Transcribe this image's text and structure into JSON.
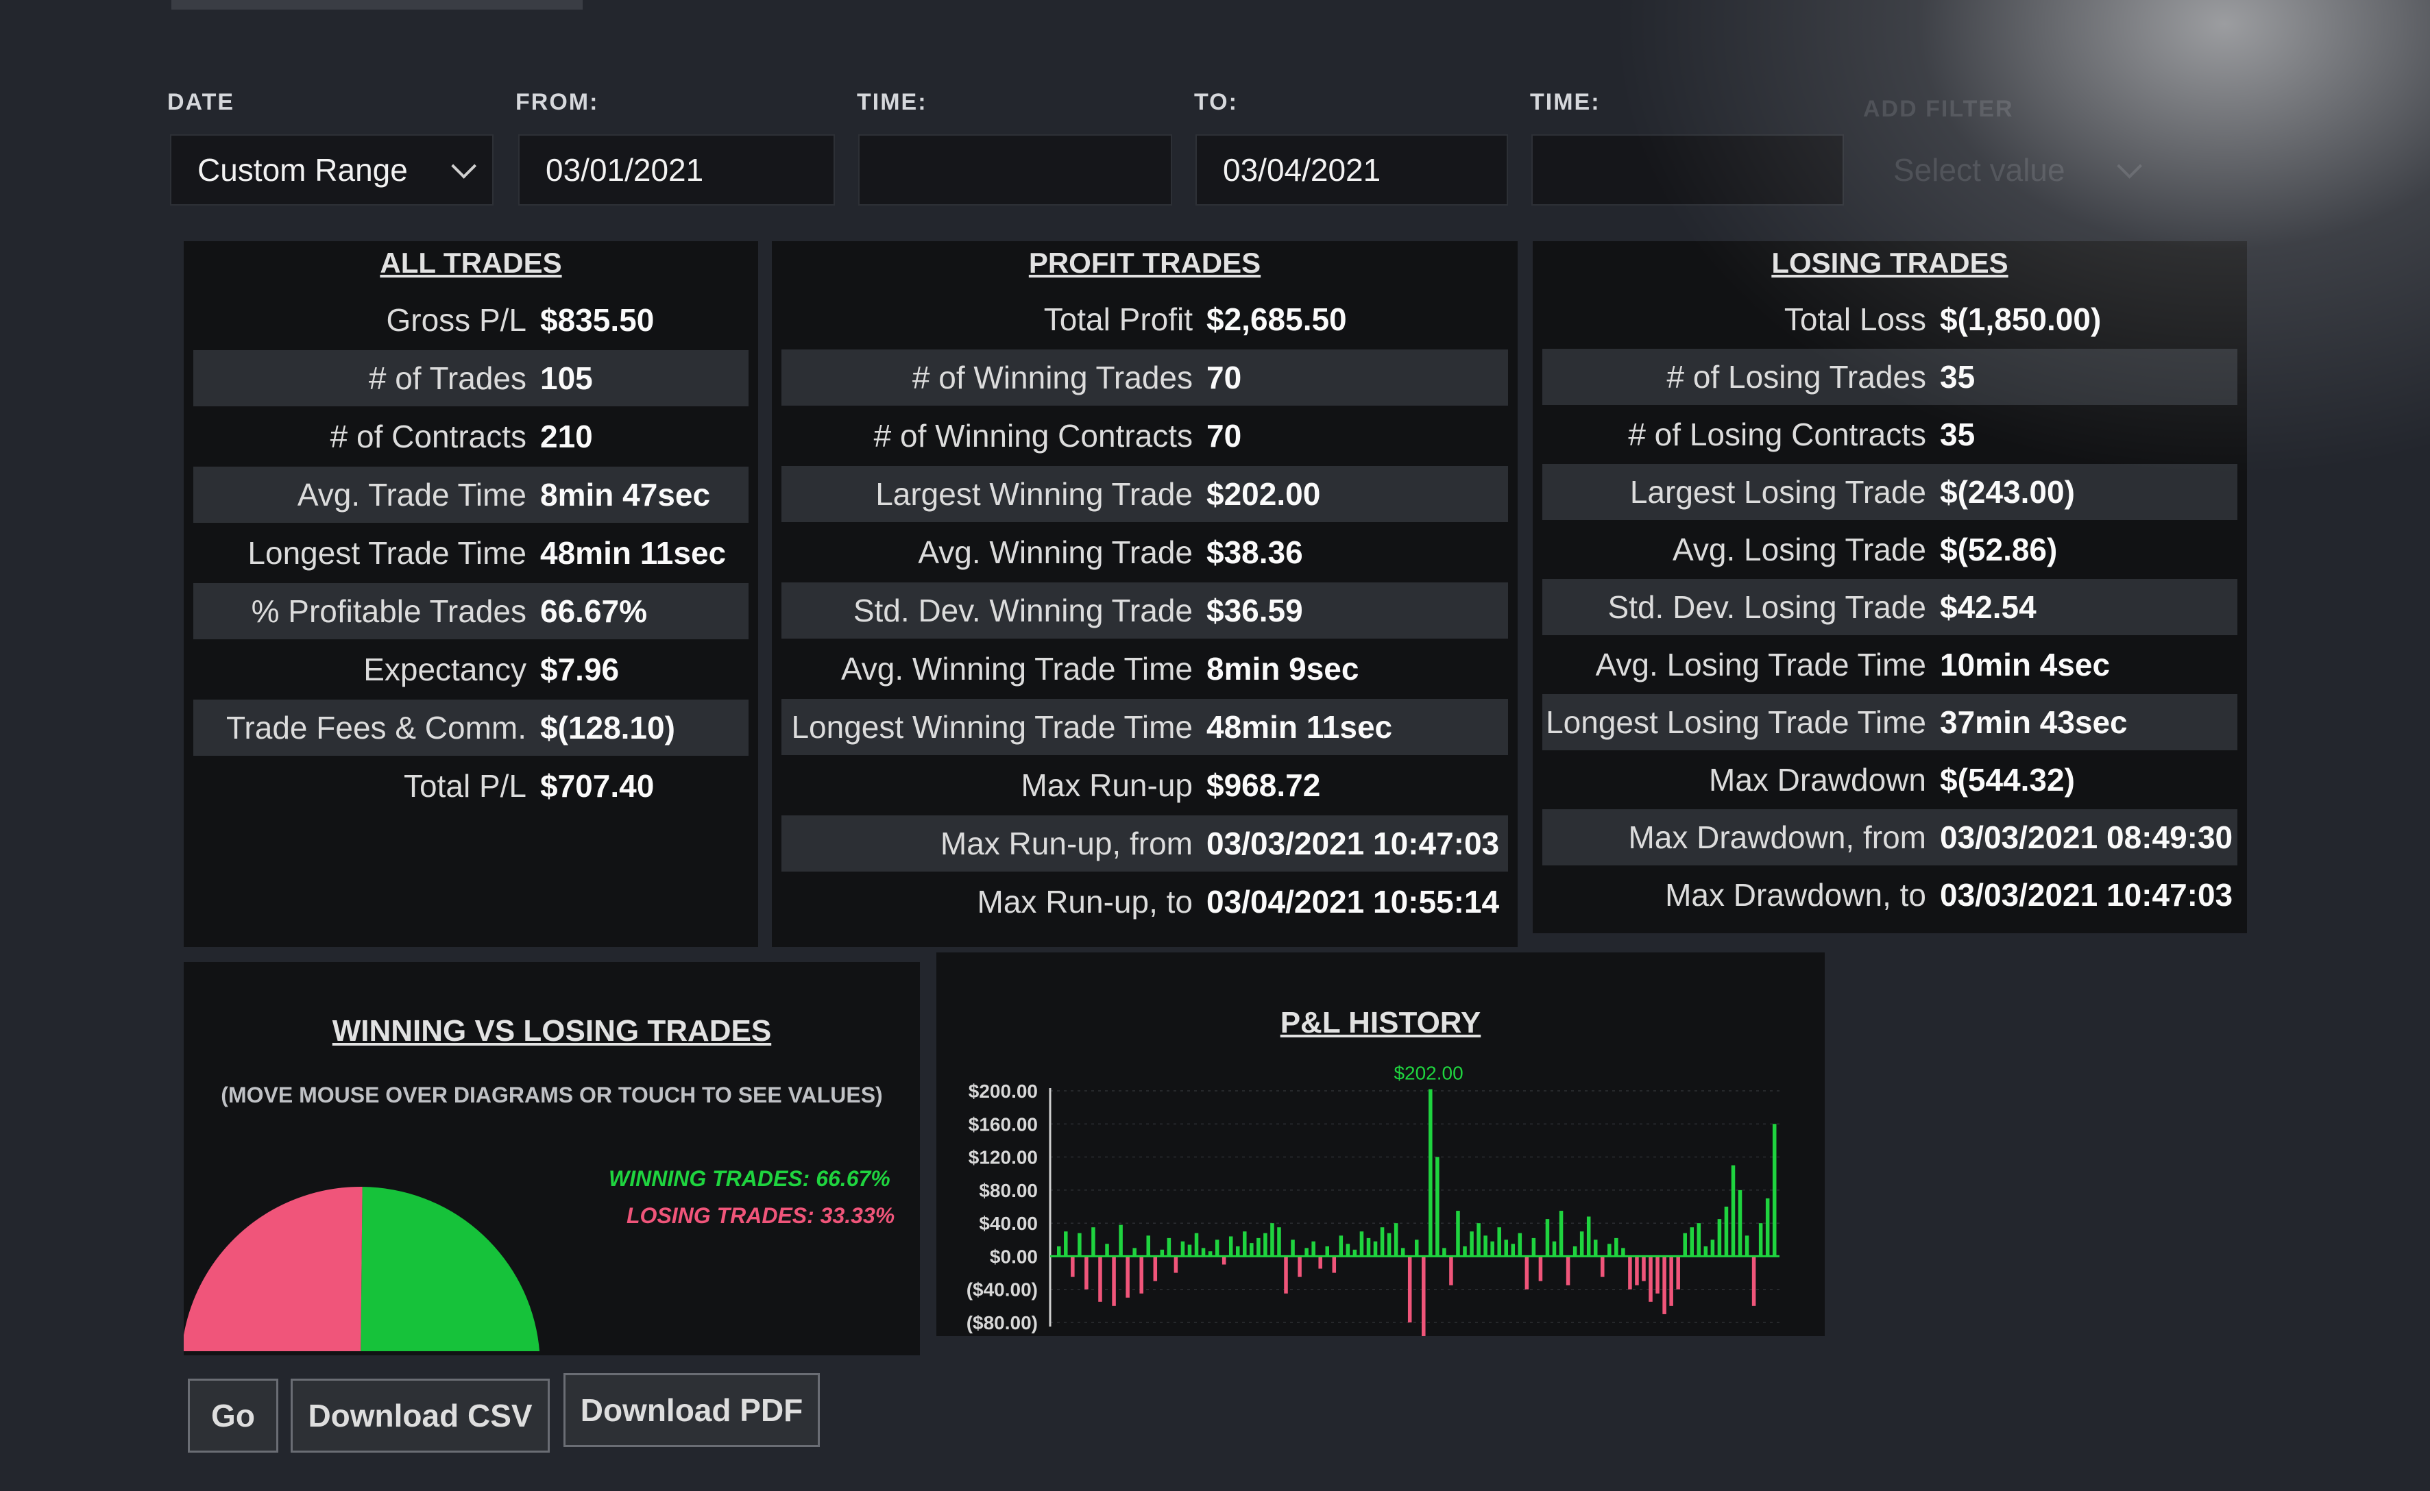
{
  "filters": {
    "date_label": "DATE",
    "date_value": "Custom Range",
    "from_label": "FROM:",
    "from_value": "03/01/2021",
    "time_label": "TIME:",
    "to_label": "TO:",
    "to_value": "03/04/2021",
    "time2_label": "TIME:",
    "add_filter_label": "ADD FILTER",
    "add_filter_value": "Select value"
  },
  "all_trades": {
    "title": "ALL TRADES",
    "rows": [
      {
        "label": "Gross P/L",
        "value": "$835.50"
      },
      {
        "label": "# of Trades",
        "value": "105"
      },
      {
        "label": "# of Contracts",
        "value": "210"
      },
      {
        "label": "Avg. Trade Time",
        "value": "8min 47sec"
      },
      {
        "label": "Longest Trade Time",
        "value": "48min 11sec"
      },
      {
        "label": "% Profitable Trades",
        "value": "66.67%"
      },
      {
        "label": "Expectancy",
        "value": "$7.96"
      },
      {
        "label": "Trade Fees & Comm.",
        "value": "$(128.10)"
      },
      {
        "label": "Total P/L",
        "value": "$707.40"
      }
    ]
  },
  "profit_trades": {
    "title": "PROFIT TRADES",
    "rows": [
      {
        "label": "Total Profit",
        "value": "$2,685.50"
      },
      {
        "label": "# of Winning Trades",
        "value": "70"
      },
      {
        "label": "# of Winning Contracts",
        "value": "70"
      },
      {
        "label": "Largest Winning Trade",
        "value": "$202.00"
      },
      {
        "label": "Avg. Winning Trade",
        "value": "$38.36"
      },
      {
        "label": "Std. Dev. Winning Trade",
        "value": "$36.59"
      },
      {
        "label": "Avg. Winning Trade Time",
        "value": "8min 9sec"
      },
      {
        "label": "Longest Winning Trade Time",
        "value": "48min 11sec"
      },
      {
        "label": "Max Run-up",
        "value": "$968.72"
      },
      {
        "label": "Max Run-up, from",
        "value": "03/03/2021 10:47:03"
      },
      {
        "label": "Max Run-up, to",
        "value": "03/04/2021 10:55:14"
      }
    ]
  },
  "losing_trades": {
    "title": "LOSING TRADES",
    "rows": [
      {
        "label": "Total Loss",
        "value": "$(1,850.00)"
      },
      {
        "label": "# of Losing Trades",
        "value": "35"
      },
      {
        "label": "# of Losing Contracts",
        "value": "35"
      },
      {
        "label": "Largest Losing Trade",
        "value": "$(243.00)"
      },
      {
        "label": "Avg. Losing Trade",
        "value": "$(52.86)"
      },
      {
        "label": "Std. Dev. Losing Trade",
        "value": "$42.54"
      },
      {
        "label": "Avg. Losing Trade Time",
        "value": "10min 4sec"
      },
      {
        "label": "Longest Losing Trade Time",
        "value": "37min 43sec"
      },
      {
        "label": "Max Drawdown",
        "value": "$(544.32)"
      },
      {
        "label": "Max Drawdown, from",
        "value": "03/03/2021 08:49:30"
      },
      {
        "label": "Max Drawdown, to",
        "value": "03/03/2021 10:47:03"
      }
    ]
  },
  "win_loss": {
    "title": "WINNING VS LOSING TRADES",
    "hint": "(MOVE MOUSE OVER DIAGRAMS OR TOUCH TO SEE VALUES)",
    "winning_label": "WINNING TRADES: 66.67%",
    "losing_label": "LOSING TRADES: 33.33%",
    "colors": {
      "winning": "#16c23a",
      "losing": "#f0557a"
    }
  },
  "pl_history": {
    "title": "P&L HISTORY",
    "peak_label": "$202.00",
    "colors": {
      "positive": "#1fd43f",
      "negative": "#f0557a"
    }
  },
  "chart_data": [
    {
      "type": "pie",
      "title": "WINNING VS LOSING TRADES",
      "labels": [
        "WINNING TRADES",
        "LOSING TRADES"
      ],
      "values": [
        66.67,
        33.33
      ],
      "legend": "right"
    },
    {
      "type": "bar",
      "title": "P&L HISTORY",
      "ylim": [
        -80,
        200
      ],
      "yticks": [
        "$200.00",
        "$160.00",
        "$120.00",
        "$80.00",
        "$40.00",
        "$0.00",
        "($40.00)",
        "($80.00)"
      ],
      "ytick_values": [
        200,
        160,
        120,
        80,
        40,
        0,
        -40,
        -80
      ],
      "grid": true,
      "values": [
        12,
        30,
        -25,
        28,
        -40,
        35,
        -55,
        15,
        -60,
        38,
        -50,
        10,
        -45,
        25,
        -30,
        8,
        22,
        -20,
        18,
        14,
        28,
        10,
        6,
        20,
        -10,
        24,
        12,
        30,
        16,
        22,
        28,
        40,
        35,
        -45,
        20,
        -25,
        10,
        18,
        -15,
        12,
        -20,
        25,
        15,
        8,
        30,
        22,
        18,
        35,
        28,
        40,
        10,
        -80,
        20,
        -110,
        202,
        120,
        10,
        -35,
        55,
        12,
        30,
        40,
        25,
        18,
        35,
        20,
        15,
        28,
        -40,
        22,
        -30,
        45,
        18,
        55,
        -35,
        12,
        30,
        48,
        20,
        -25,
        15,
        22,
        10,
        -40,
        -35,
        -30,
        -55,
        -45,
        -70,
        -60,
        -40,
        28,
        35,
        40,
        12,
        20,
        45,
        60,
        110,
        80,
        25,
        -60,
        40,
        70,
        160
      ]
    }
  ],
  "actions": {
    "go": "Go",
    "csv": "Download CSV",
    "pdf": "Download PDF"
  }
}
